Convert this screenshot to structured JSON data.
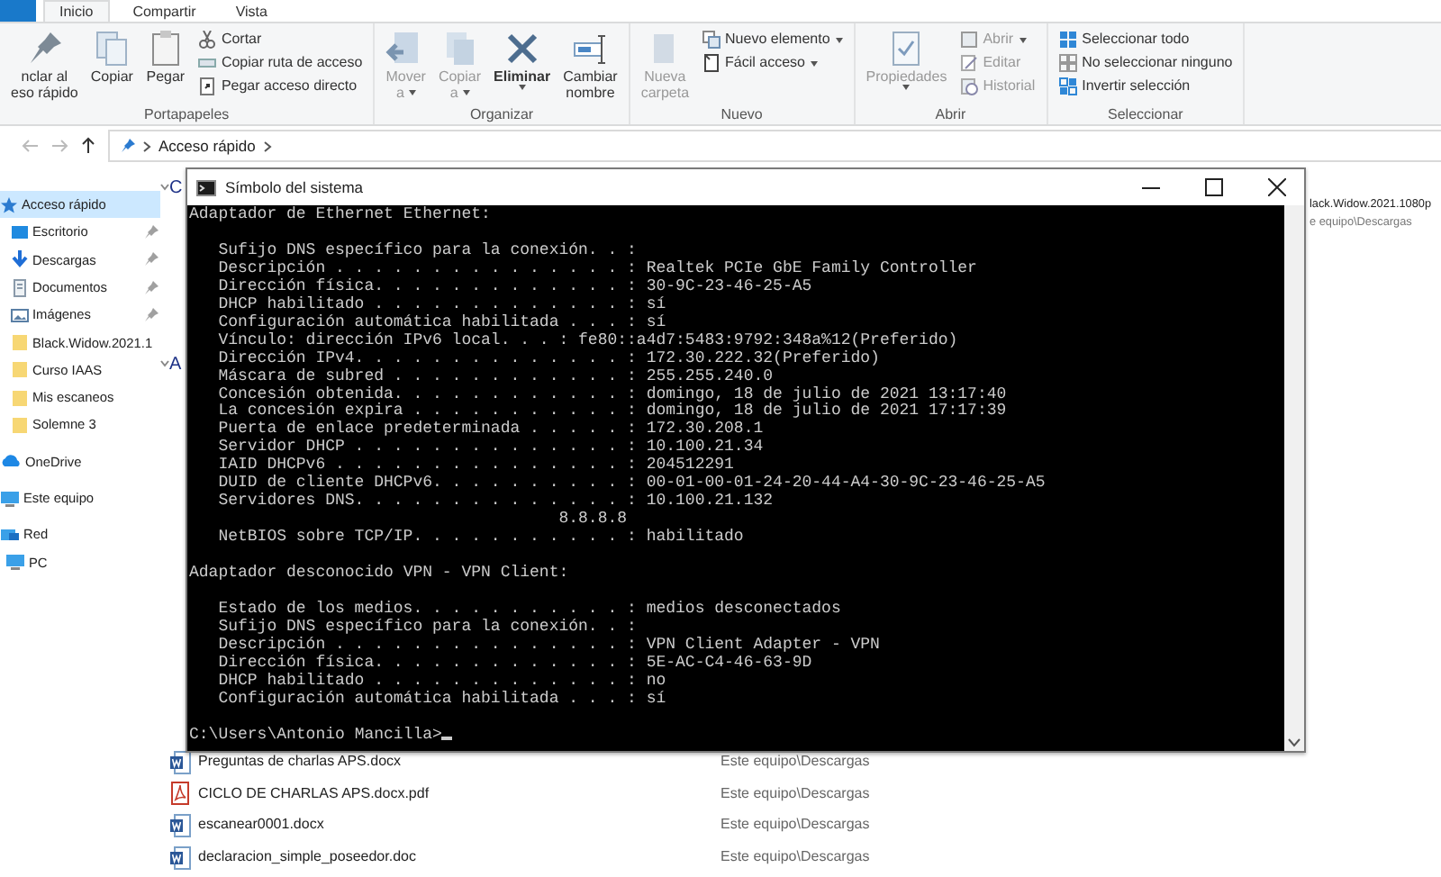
{
  "ribbon_tabs": [
    {
      "label": "Inicio",
      "selected": true
    },
    {
      "label": "Compartir",
      "selected": false
    },
    {
      "label": "Vista",
      "selected": false
    }
  ],
  "ribbon_groups": [
    {
      "label": "Portapapeles",
      "large": [
        {
          "lines": [
            "nclar al",
            "eso rápido"
          ],
          "disabled": false,
          "dropdown": false
        },
        {
          "lines": [
            "Copiar"
          ],
          "disabled": false,
          "dropdown": false
        },
        {
          "lines": [
            "Pegar"
          ],
          "disabled": false,
          "dropdown": false
        }
      ],
      "small": [
        {
          "label": "Cortar",
          "disabled": false,
          "dropdown": false
        },
        {
          "label": "Copiar ruta de acceso",
          "disabled": false,
          "dropdown": false
        },
        {
          "label": "Pegar acceso directo",
          "disabled": false,
          "dropdown": false
        }
      ]
    },
    {
      "label": "Organizar",
      "large": [
        {
          "lines": [
            "Mover",
            "a"
          ],
          "disabled": true,
          "dropdown": true
        },
        {
          "lines": [
            "Copiar",
            "a"
          ],
          "disabled": true,
          "dropdown": true
        },
        {
          "lines": [
            "Eliminar"
          ],
          "disabled": false,
          "dropdown": true,
          "emphasis": true
        },
        {
          "lines": [
            "Cambiar",
            "nombre"
          ],
          "disabled": false,
          "dropdown": false
        }
      ]
    },
    {
      "label": "Nuevo",
      "large": [
        {
          "lines": [
            "Nueva",
            "carpeta"
          ],
          "disabled": true,
          "dropdown": false
        }
      ],
      "small": [
        {
          "label": "Nuevo elemento",
          "disabled": false,
          "dropdown": true
        },
        {
          "label": "Fácil acceso",
          "disabled": false,
          "dropdown": true
        }
      ]
    },
    {
      "label": "Abrir",
      "large": [
        {
          "lines": [
            "Propiedades"
          ],
          "disabled": true,
          "dropdown": true
        }
      ],
      "small": [
        {
          "label": "Abrir",
          "disabled": true,
          "dropdown": true
        },
        {
          "label": "Editar",
          "disabled": true,
          "dropdown": false
        },
        {
          "label": "Historial",
          "disabled": true,
          "dropdown": false
        }
      ]
    },
    {
      "label": "Seleccionar",
      "small": [
        {
          "label": "Seleccionar todo",
          "disabled": false,
          "dropdown": false
        },
        {
          "label": "No seleccionar ninguno",
          "disabled": false,
          "dropdown": false
        },
        {
          "label": "Invertir selección",
          "disabled": false,
          "dropdown": false
        }
      ]
    }
  ],
  "address_bar": {
    "path": [
      "Acceso rápido"
    ]
  },
  "navigation": [
    {
      "label": "Acceso rápido",
      "selected": true,
      "children": [
        {
          "label": "Escritorio",
          "selected": false,
          "pinned": true
        },
        {
          "label": "Descargas",
          "selected": false,
          "pinned": true
        },
        {
          "label": "Documentos",
          "selected": false,
          "pinned": true
        },
        {
          "label": "Imágenes",
          "selected": false,
          "pinned": true
        },
        {
          "label": "Black.Widow.2021.1",
          "selected": false,
          "pinned": false
        },
        {
          "label": "Curso IAAS",
          "selected": false,
          "pinned": false
        },
        {
          "label": "Mis escaneos",
          "selected": false,
          "pinned": false
        },
        {
          "label": "Solemne 3",
          "selected": false,
          "pinned": false
        }
      ]
    },
    {
      "label": "OneDrive",
      "selected": false
    },
    {
      "label": "Este equipo",
      "selected": false
    },
    {
      "label": "Red",
      "selected": false,
      "children": [
        {
          "label": "PC",
          "selected": false
        }
      ]
    }
  ],
  "content": {
    "section_headings": [
      "C",
      "A"
    ],
    "recent_item": {
      "name": "lack.Widow.2021.1080p",
      "location": "e equipo\\Descargas"
    },
    "files": [
      {
        "name": "Preguntas de charlas APS.docx",
        "location": "Este equipo\\Descargas",
        "kind": "word"
      },
      {
        "name": "CICLO DE CHARLAS APS.docx.pdf",
        "location": "Este equipo\\Descargas",
        "kind": "pdf"
      },
      {
        "name": "escanear0001.docx",
        "location": "Este equipo\\Descargas",
        "kind": "word"
      },
      {
        "name": "declaracion_simple_poseedor.doc",
        "location": "Este equipo\\Descargas",
        "kind": "word"
      }
    ]
  },
  "console": {
    "title": "Símbolo del sistema",
    "blocks": [
      {
        "heading": "Adaptador de Ethernet Ethernet:",
        "lines": [
          {
            "text": "Sufijo DNS específico para la conexión. . :",
            "kind": "entry"
          },
          {
            "text": "Descripción . . . . . . . . . . . . . . . : Realtek PCIe GbE Family Controller",
            "kind": "entry"
          },
          {
            "text": "Dirección física. . . . . . . . . . . . . : 30-9C-23-46-25-A5",
            "kind": "entry"
          },
          {
            "text": "DHCP habilitado . . . . . . . . . . . . . : sí",
            "kind": "entry"
          },
          {
            "text": "Configuración automática habilitada . . . : sí",
            "kind": "entry"
          },
          {
            "text": "Vínculo: dirección IPv6 local. . . : fe80::a4d7:5483:9792:348a%12(Preferido)",
            "kind": "entry"
          },
          {
            "text": "Dirección IPv4. . . . . . . . . . . . . . : 172.30.222.32(Preferido)",
            "kind": "entry"
          },
          {
            "text": "Máscara de subred . . . . . . . . . . . . : 255.255.240.0",
            "kind": "entry"
          },
          {
            "text": "Concesión obtenida. . . . . . . . . . . . : domingo, 18 de julio de 2021 13:17:40",
            "kind": "entry"
          },
          {
            "text": "La concesión expira . . . . . . . . . . . : domingo, 18 de julio de 2021 17:17:39",
            "kind": "entry"
          },
          {
            "text": "Puerta de enlace predeterminada . . . . . : 172.30.208.1",
            "kind": "entry"
          },
          {
            "text": "Servidor DHCP . . . . . . . . . . . . . . : 10.100.21.34",
            "kind": "entry"
          },
          {
            "text": "IAID DHCPv6 . . . . . . . . . . . . . . . : 204512291",
            "kind": "entry"
          },
          {
            "text": "DUID de cliente DHCPv6. . . . . . . . . . : 00-01-00-01-24-20-44-A4-30-9C-23-46-25-A5",
            "kind": "entry"
          },
          {
            "text": "Servidores DNS. . . . . . . . . . . . . . : 10.100.21.132",
            "kind": "entry"
          },
          {
            "text": "8.8.8.8",
            "kind": "continuation"
          },
          {
            "text": "NetBIOS sobre TCP/IP. . . . . . . . . . . : habilitado",
            "kind": "entry"
          }
        ]
      },
      {
        "heading": "Adaptador desconocido VPN - VPN Client:",
        "lines": [
          {
            "text": "Estado de los medios. . . . . . . . . . . : medios desconectados",
            "kind": "entry"
          },
          {
            "text": "Sufijo DNS específico para la conexión. . :",
            "kind": "entry"
          },
          {
            "text": "Descripción . . . . . . . . . . . . . . . : VPN Client Adapter - VPN",
            "kind": "entry"
          },
          {
            "text": "Dirección física. . . . . . . . . . . . . : 5E-AC-C4-46-63-9D",
            "kind": "entry"
          },
          {
            "text": "DHCP habilitado . . . . . . . . . . . . . : no",
            "kind": "entry"
          },
          {
            "text": "Configuración automática habilitada . . . : sí",
            "kind": "entry"
          }
        ]
      }
    ],
    "prompt": "C:\\Users\\Antonio Mancilla>"
  }
}
